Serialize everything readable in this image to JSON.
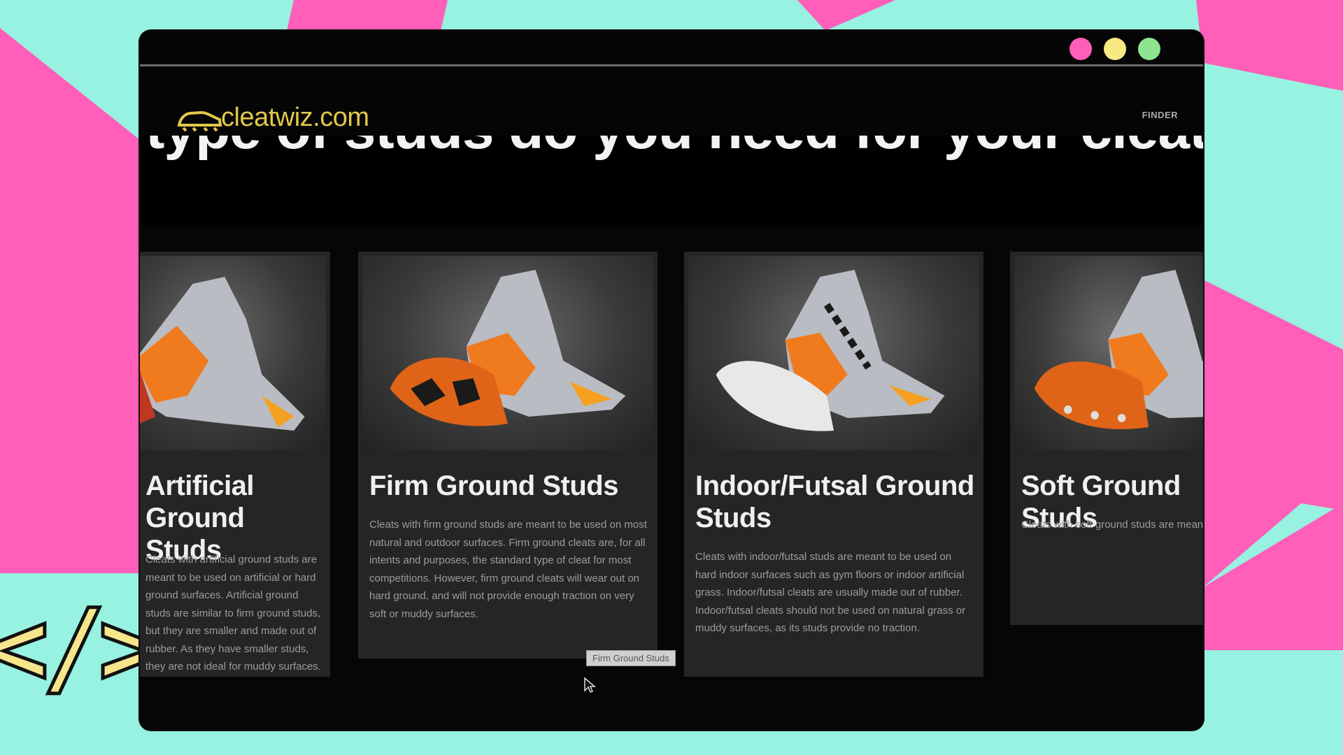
{
  "window": {
    "traffic_lights": [
      {
        "name": "close",
        "color": "#ff5fb8"
      },
      {
        "name": "minimize",
        "color": "#f8ea82"
      },
      {
        "name": "maximize",
        "color": "#8ee48e"
      }
    ]
  },
  "site": {
    "logo_text": "cleatwiz.com",
    "logo_icon": "cleat-shoe-icon",
    "nav_finder": "FINDER"
  },
  "hero": {
    "title": "What type of studs do you need for your cleats?"
  },
  "cards": [
    {
      "title": "Artificial Ground Studs",
      "text": "Cleats with artificial ground studs are meant to be used on artificial or hard ground surfaces. Artificial ground studs are similar to firm ground studs, but they are smaller and made out of rubber. As they have smaller studs, they are not ideal for muddy surfaces."
    },
    {
      "title": "Firm Ground Studs",
      "text": "Cleats with firm ground studs are meant to be used on most natural and outdoor surfaces. Firm ground cleats are, for all intents and purposes, the standard type of cleat for most competitions. However, firm ground cleats will wear out on hard ground, and will not provide enough traction on very soft or muddy surfaces."
    },
    {
      "title": "Indoor/Futsal Ground Studs",
      "text": "Cleats with indoor/futsal studs are meant to be used on hard indoor surfaces such as gym floors or indoor artificial grass. Indoor/futsal cleats are usually made out of rubber. Indoor/futsal cleats should not be used on natural grass or muddy surfaces, as its studs provide no traction."
    },
    {
      "title": "Soft Ground Studs",
      "text": "Cleats with soft ground studs are meant to be used on wet and muddy fields. Soft ground studs are usually detachable and made of metal. Soft ground cleats are not ideal for hard surfaces, as they will easily lose traction."
    }
  ],
  "tooltip": "Firm Ground Studs",
  "decor": {
    "code_symbol": "</>",
    "colors": {
      "teal": "#97f2e1",
      "pink": "#ff5fb8",
      "yellow": "#f6e58b",
      "orange": "#f07a1e"
    }
  }
}
